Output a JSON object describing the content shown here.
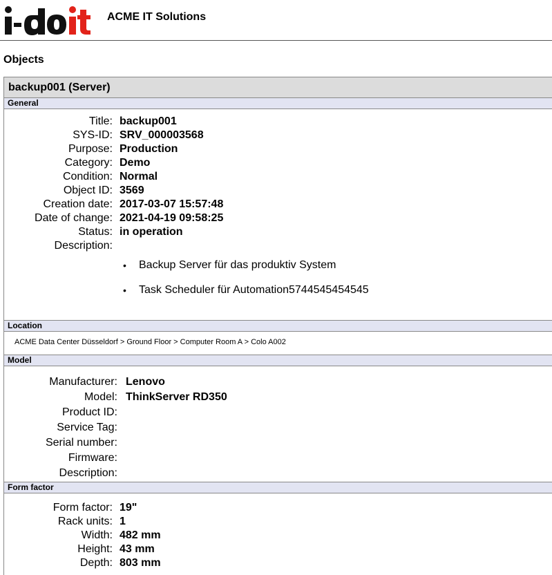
{
  "header": {
    "logo_text": "i-doit",
    "company": "ACME IT Solutions"
  },
  "page": {
    "heading": "Objects"
  },
  "object": {
    "title": "backup001 (Server)"
  },
  "general": {
    "section": "General",
    "fields": [
      {
        "label": "Title:",
        "value": "backup001"
      },
      {
        "label": "SYS-ID:",
        "value": "SRV_000003568"
      },
      {
        "label": "Purpose:",
        "value": "Production"
      },
      {
        "label": "Category:",
        "value": "Demo"
      },
      {
        "label": "Condition:",
        "value": "Normal"
      },
      {
        "label": "Object ID:",
        "value": "3569"
      },
      {
        "label": "Creation date:",
        "value": "2017-03-07 15:57:48"
      },
      {
        "label": "Date of change:",
        "value": "2021-04-19 09:58:25"
      },
      {
        "label": "Status:",
        "value": "in operation"
      }
    ],
    "description_label": "Description:",
    "description_items": [
      "Backup Server für das produktiv System",
      "Task Scheduler für Automation5744545454545"
    ]
  },
  "location": {
    "section": "Location",
    "path": "ACME Data Center Düsseldorf > Ground Floor > Computer Room A > Colo A002"
  },
  "model": {
    "section": "Model",
    "fields": [
      {
        "label": "Manufacturer:",
        "value": "Lenovo"
      },
      {
        "label": "Model:",
        "value": "ThinkServer RD350"
      },
      {
        "label": "Product ID:",
        "value": ""
      },
      {
        "label": "Service Tag:",
        "value": ""
      },
      {
        "label": "Serial number:",
        "value": ""
      },
      {
        "label": "Firmware:",
        "value": ""
      },
      {
        "label": "Description:",
        "value": ""
      }
    ]
  },
  "form_factor": {
    "section": "Form factor",
    "fields": [
      {
        "label": "Form factor:",
        "value": "19\""
      },
      {
        "label": "Rack units:",
        "value": "1"
      },
      {
        "label": "Width:",
        "value": "482 mm"
      },
      {
        "label": "Height:",
        "value": "43 mm"
      },
      {
        "label": "Depth:",
        "value": "803 mm"
      }
    ]
  },
  "colors": {
    "logo_black": "#111111",
    "logo_red": "#e2231a",
    "title_bar": "#dcdcdc",
    "section_header": "#e2e4f2"
  }
}
